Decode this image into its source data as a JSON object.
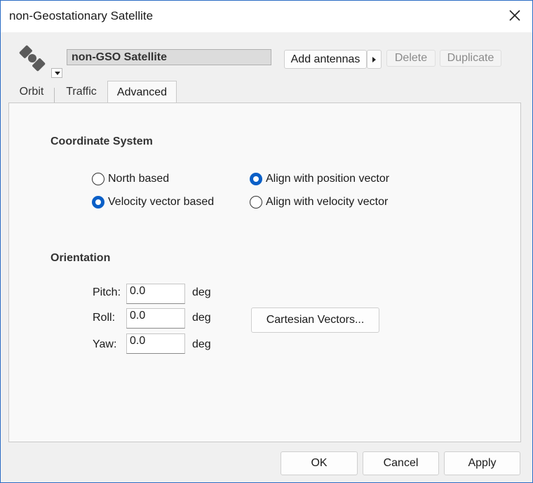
{
  "window": {
    "title": "non-Geostationary Satellite"
  },
  "header": {
    "name": "non-GSO Satellite",
    "add_antennas": "Add antennas",
    "delete": "Delete",
    "duplicate": "Duplicate"
  },
  "tabs": [
    {
      "label": "Orbit",
      "active": false
    },
    {
      "label": "Traffic",
      "active": false
    },
    {
      "label": "Advanced",
      "active": true
    }
  ],
  "coordinate_system": {
    "title": "Coordinate System",
    "options": [
      {
        "label": "North based",
        "checked": false
      },
      {
        "label": "Velocity vector based",
        "checked": true
      },
      {
        "label": "Align with position vector",
        "checked": true
      },
      {
        "label": "Align with velocity vector",
        "checked": false
      }
    ]
  },
  "orientation": {
    "title": "Orientation",
    "pitch_label": "Pitch:",
    "pitch_value": "0.0",
    "roll_label": "Roll:",
    "roll_value": "0.0",
    "yaw_label": "Yaw:",
    "yaw_value": "0.0",
    "unit": "deg",
    "cartesian_button": "Cartesian Vectors..."
  },
  "footer": {
    "ok": "OK",
    "cancel": "Cancel",
    "apply": "Apply"
  },
  "colors": {
    "accent": "#0a5fc7",
    "window_border": "#2b6cc4"
  },
  "icons": {
    "app": "satellite-icon",
    "close": "close-icon",
    "menu": "dropdown-arrow-icon",
    "split": "chevron-right-icon"
  }
}
